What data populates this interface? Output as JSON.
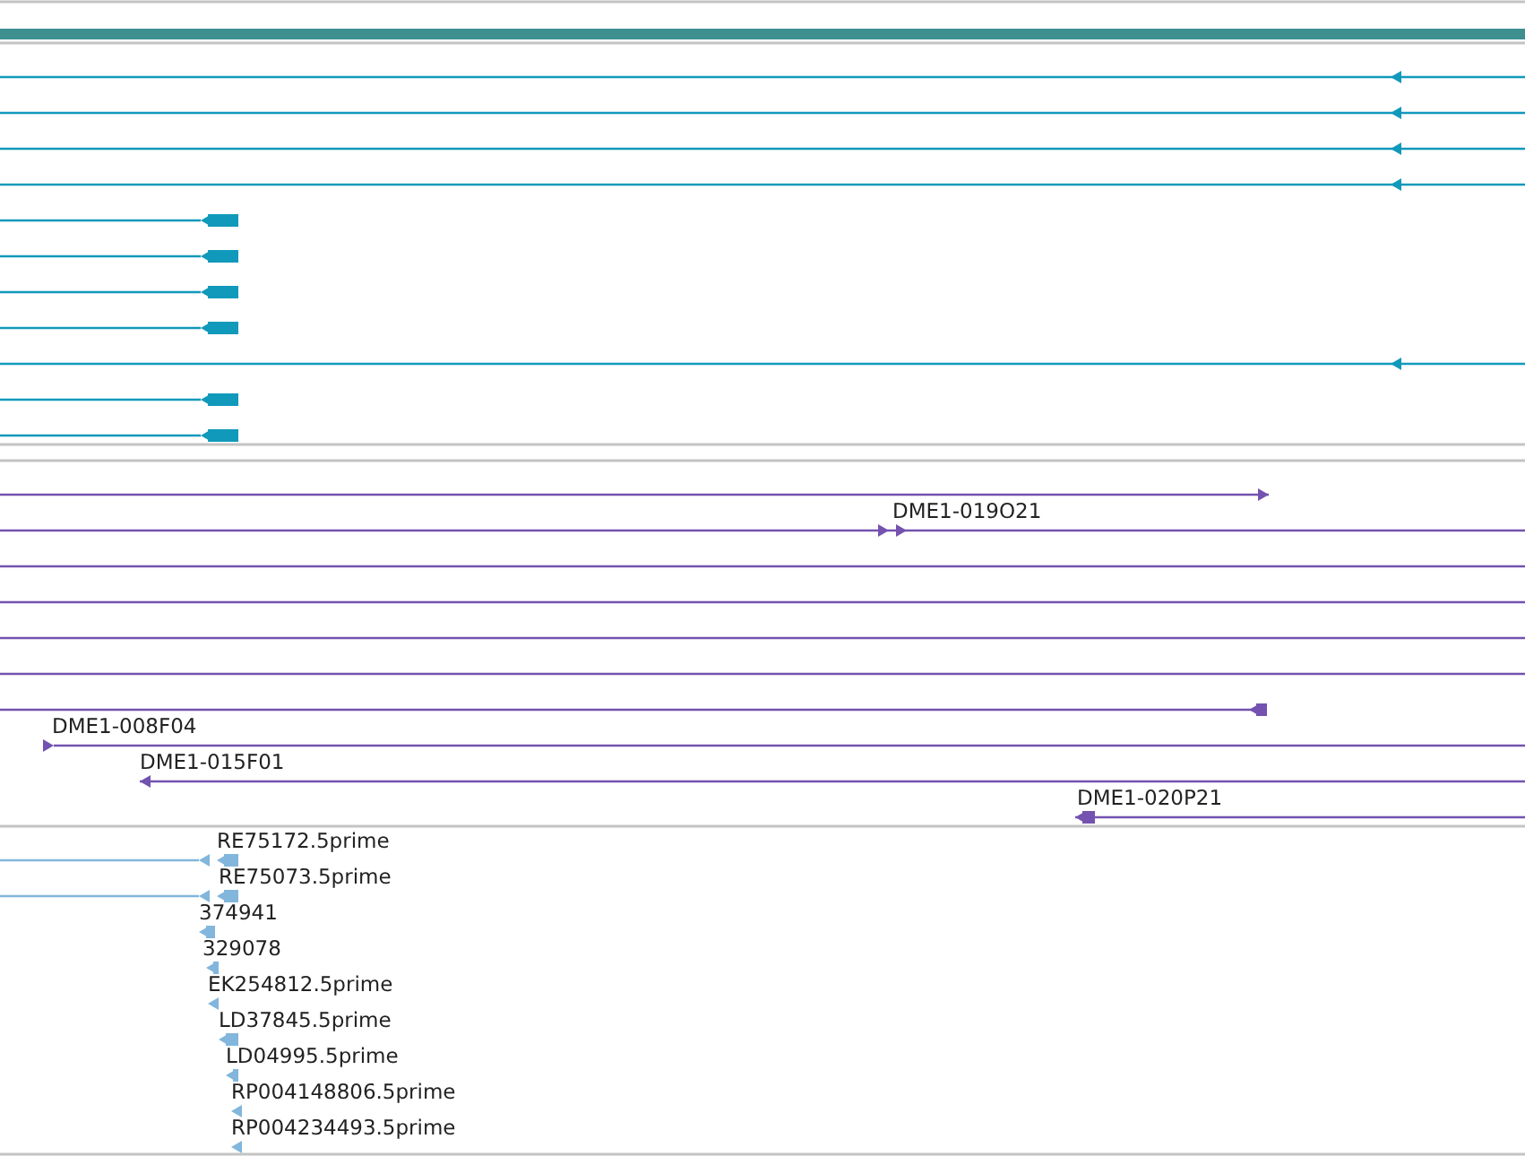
{
  "tracks": [
    {
      "color": "#1199bb",
      "features": [
        {
          "kind": "arrow",
          "reverse": true
        },
        {
          "kind": "arrow",
          "reverse": true
        },
        {
          "kind": "arrow",
          "reverse": true
        },
        {
          "kind": "arrow",
          "reverse": true
        },
        {
          "kind": "arrow",
          "reverse": true
        },
        {
          "kind": "arrow",
          "reverse": true
        },
        {
          "kind": "arrow",
          "reverse": true
        },
        {
          "kind": "arrow",
          "reverse": true
        },
        {
          "kind": "arrow",
          "reverse": true
        },
        {
          "kind": "arrow",
          "reverse": true
        },
        {
          "kind": "arrow",
          "reverse": true
        }
      ]
    },
    {
      "color": "#7452b0",
      "features": [
        {
          "kind": "arrow",
          "reverse": false
        },
        {
          "kind": "arrow",
          "reverse": false,
          "label": "DME1-019O21"
        },
        {
          "kind": "plain"
        },
        {
          "kind": "plain"
        },
        {
          "kind": "plain"
        },
        {
          "kind": "plain"
        },
        {
          "kind": "arrow",
          "reverse": true
        },
        {
          "kind": "arrow",
          "reverse": false,
          "label": "DME1-008F04"
        },
        {
          "kind": "arrow",
          "reverse": true,
          "label": "DME1-015F01"
        },
        {
          "kind": "arrow",
          "reverse": true,
          "label": "DME1-020P21"
        }
      ]
    },
    {
      "color": "#82b6dc",
      "features": [
        {
          "kind": "arrow",
          "reverse": true,
          "label": "RE75172.5prime"
        },
        {
          "kind": "arrow",
          "reverse": true,
          "label": "RE75073.5prime"
        },
        {
          "kind": "arrow",
          "reverse": true,
          "label": "374941"
        },
        {
          "kind": "arrow",
          "reverse": true,
          "label": "329078"
        },
        {
          "kind": "arrow",
          "reverse": true,
          "label": "EK254812.5prime"
        },
        {
          "kind": "arrow",
          "reverse": true,
          "label": "LD37845.5prime"
        },
        {
          "kind": "arrow",
          "reverse": true,
          "label": "LD04995.5prime"
        },
        {
          "kind": "arrow",
          "reverse": true,
          "label": "RP004148806.5prime"
        },
        {
          "kind": "arrow",
          "reverse": true,
          "label": "RP004234493.5prime"
        }
      ]
    }
  ]
}
